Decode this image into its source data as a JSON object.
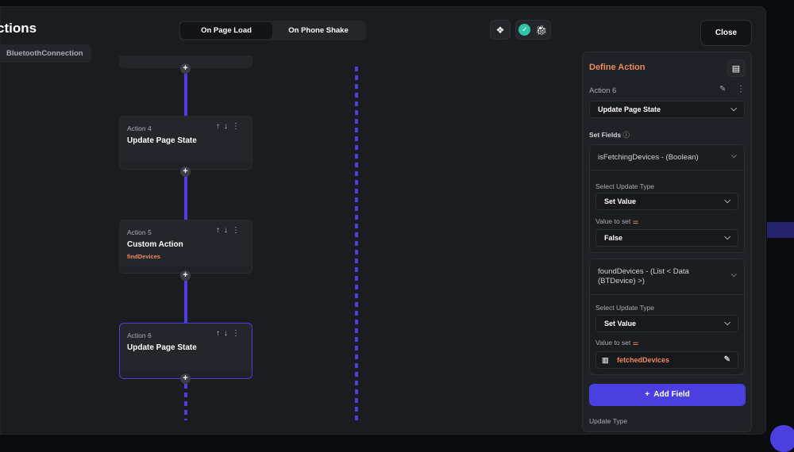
{
  "header": {
    "title": "ctions",
    "page_chip": "BluetoothConnection",
    "tabs": [
      "On Page Load",
      "On Phone Shake"
    ],
    "close_label": "Close"
  },
  "actions": [
    {
      "label": "Action 4",
      "name": "Update Page State",
      "subtitle": null
    },
    {
      "label": "Action 5",
      "name": "Custom Action",
      "subtitle": "findDevices"
    },
    {
      "label": "Action 6",
      "name": "Update Page State",
      "subtitle": null
    }
  ],
  "panel": {
    "title": "Define Action",
    "action_label": "Action 6",
    "action_type": "Update Page State",
    "set_fields_label": "Set Fields",
    "fields": [
      {
        "name": "isFetchingDevices - (Boolean)",
        "update_type_label": "Select Update Type",
        "update_type": "Set Value",
        "value_label": "Value to set",
        "value": "False"
      },
      {
        "name": "foundDevices - (List < Data (BTDevice) >)",
        "update_type_label": "Select Update Type",
        "update_type": "Set Value",
        "value_label": "Value to set",
        "value": "fetchedDevices"
      }
    ],
    "add_field_label": "Add Field",
    "update_type_label": "Update Type"
  },
  "colors": {
    "accent": "#4b3fe0",
    "orange": "#ee8a5a",
    "check": "#2ec4a5"
  }
}
